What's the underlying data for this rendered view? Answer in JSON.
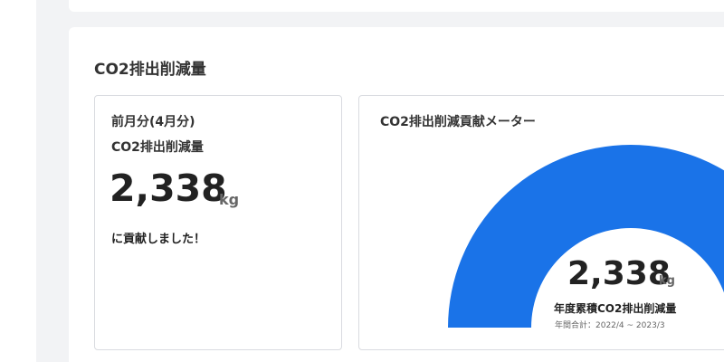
{
  "section": {
    "title": "CO2排出削減量"
  },
  "monthly": {
    "period_label": "前月分(4月分)",
    "metric_label": "CO2排出削減量",
    "value": "2,338",
    "unit": "kg",
    "contribution_text": "に貢献しました！"
  },
  "meter": {
    "title": "CO2排出削減貢献メーター",
    "value": "2,338",
    "unit": "kg",
    "label": "年度累積CO2排出削減量",
    "period": "年間合計：2022/4 ~ 2023/3",
    "color": "#1a73e8"
  }
}
